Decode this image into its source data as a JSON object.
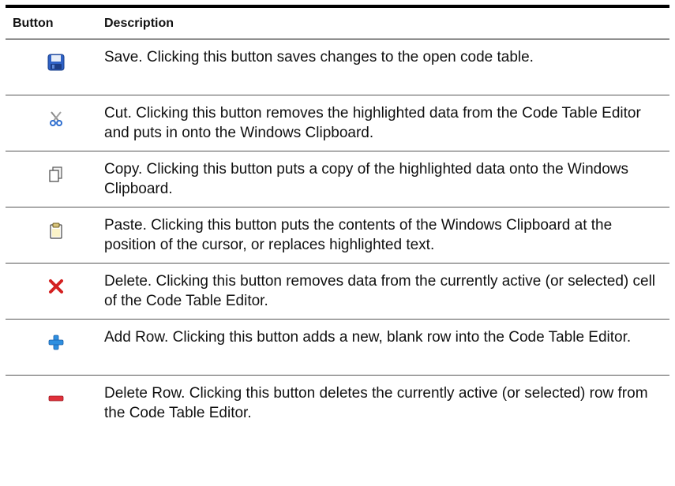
{
  "table": {
    "header": {
      "button": "Button",
      "description": "Description"
    },
    "rows": [
      {
        "icon": "save-icon",
        "description": "Save. Clicking this button saves changes to the open code table."
      },
      {
        "icon": "cut-icon",
        "description": "Cut. Clicking this button removes the highlighted data from the Code Table Editor and puts in onto the Windows Clipboard."
      },
      {
        "icon": "copy-icon",
        "description": "Copy. Clicking this button puts a copy of the highlighted data onto the Windows Clipboard."
      },
      {
        "icon": "paste-icon",
        "description": "Paste. Clicking this button puts the contents of the Windows Clipboard at the position of the cursor, or replaces highlighted text."
      },
      {
        "icon": "delete-icon",
        "description": "Delete. Clicking this button removes data from the currently active (or selected) cell of the Code Table Editor."
      },
      {
        "icon": "add-row-icon",
        "description": "Add Row. Clicking this button adds a new, blank row into the Code Table Editor."
      },
      {
        "icon": "delete-row-icon",
        "description": "Delete Row. Clicking this button deletes the currently active (or selected) row from the Code Table Editor."
      }
    ]
  },
  "colors": {
    "save_blue": "#2f62c6",
    "delete_red": "#d42020",
    "add_blue": "#2e8fe0",
    "remove_red": "#e0303a"
  }
}
